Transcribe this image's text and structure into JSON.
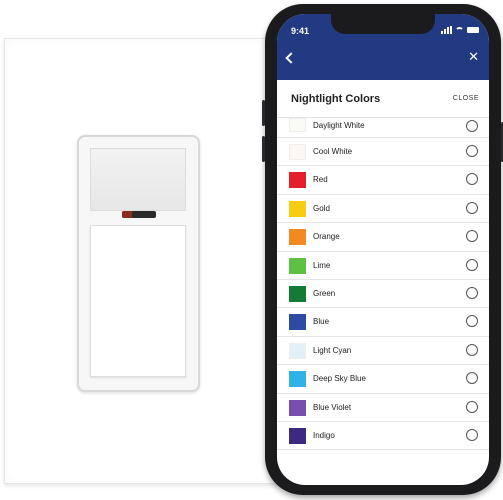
{
  "status_bar": {
    "time": "9:41"
  },
  "sheet": {
    "title": "Nightlight Colors",
    "close_label": "CLOSE"
  },
  "colors": [
    {
      "label": "Daylight White",
      "swatch": "#fbfbf6"
    },
    {
      "label": "Cool White",
      "swatch": "#fbf7f3"
    },
    {
      "label": "Red",
      "swatch": "#e4202b"
    },
    {
      "label": "Gold",
      "swatch": "#f6cd12"
    },
    {
      "label": "Orange",
      "swatch": "#f18a21"
    },
    {
      "label": "Lime",
      "swatch": "#5fc144"
    },
    {
      "label": "Green",
      "swatch": "#157a35"
    },
    {
      "label": "Blue",
      "swatch": "#2f4aa2"
    },
    {
      "label": "Light Cyan",
      "swatch": "#e2f1f8"
    },
    {
      "label": "Deep Sky Blue",
      "swatch": "#2fb3e6"
    },
    {
      "label": "Blue Violet",
      "swatch": "#7a4eab"
    },
    {
      "label": "Indigo",
      "swatch": "#3d2a7e"
    }
  ],
  "theme": {
    "app_bar": "#223a82"
  }
}
